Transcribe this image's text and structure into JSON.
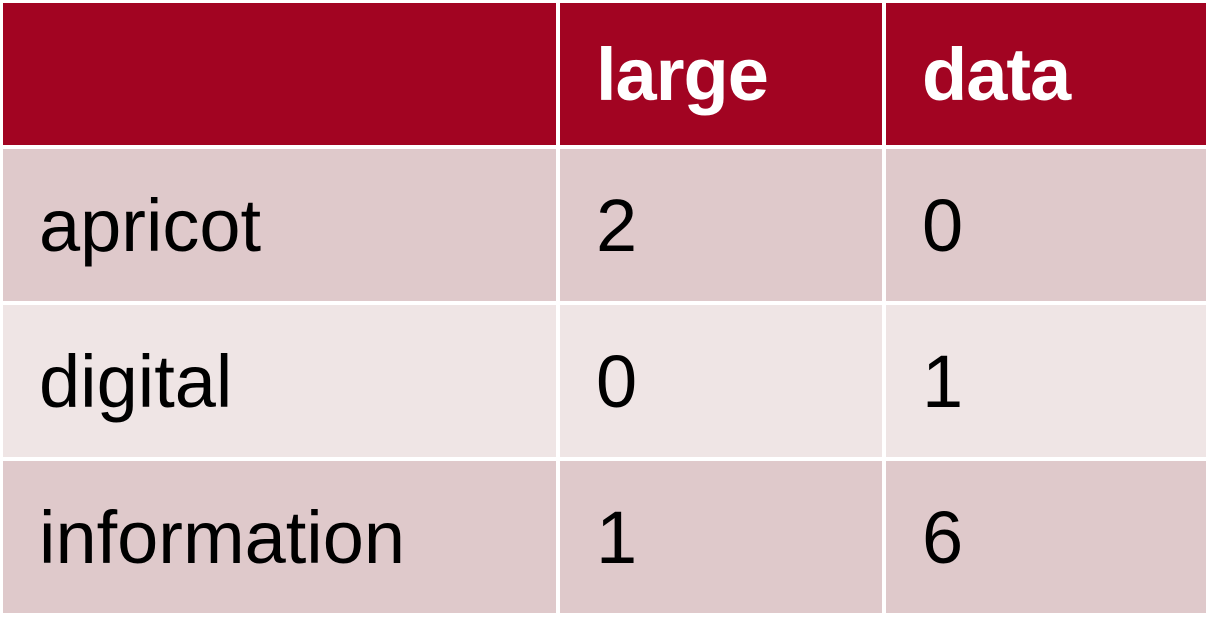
{
  "table": {
    "columns": [
      "",
      "large",
      "data"
    ],
    "rows": [
      {
        "label": "apricot",
        "values": [
          "2",
          "0"
        ]
      },
      {
        "label": "digital",
        "values": [
          "0",
          "1"
        ]
      },
      {
        "label": "information",
        "values": [
          "1",
          "6"
        ]
      }
    ]
  },
  "colors": {
    "header_background": "#a20422",
    "header_text": "#ffffff",
    "row_odd_background": "#dfc9cb",
    "row_even_background": "#efe5e5",
    "body_text": "#000000"
  }
}
